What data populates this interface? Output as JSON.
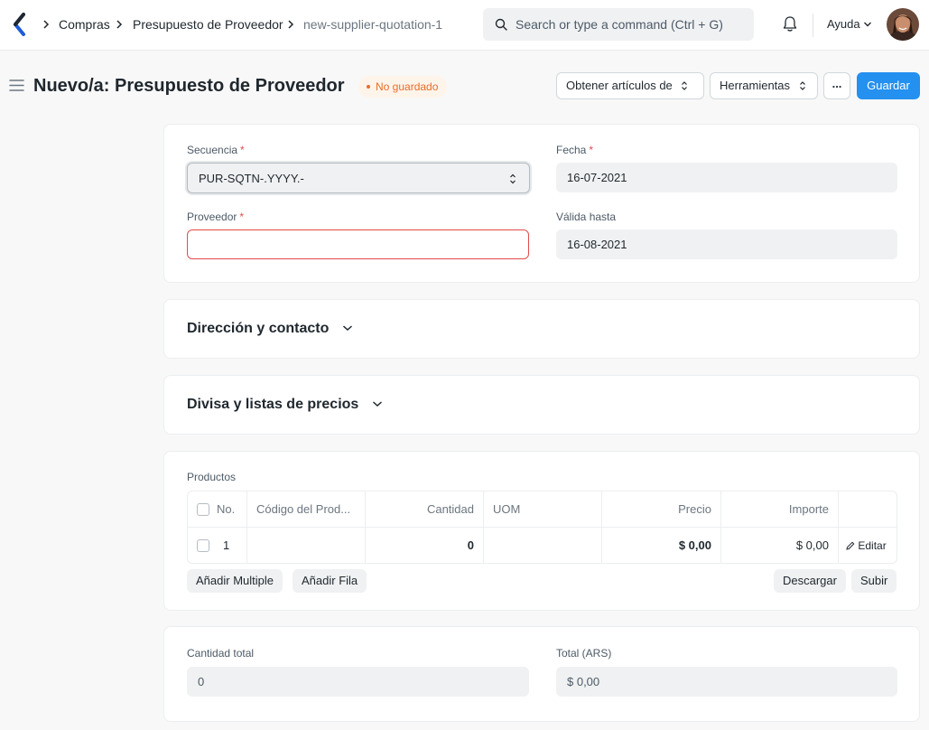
{
  "navbar": {
    "breadcrumbs": [
      "Compras",
      "Presupuesto de Proveedor",
      "new-supplier-quotation-1"
    ],
    "search_placeholder": "Search or type a command (Ctrl + G)",
    "help_label": "Ayuda"
  },
  "page": {
    "title": "Nuevo/a: Presupuesto de Proveedor",
    "status_badge": "No guardado",
    "actions": {
      "get_items": "Obtener artículos de",
      "tools": "Herramientas",
      "more": "...",
      "save": "Guardar"
    }
  },
  "form": {
    "series_label": "Secuencia",
    "series_value": "PUR-SQTN-.YYYY.-",
    "date_label": "Fecha",
    "date_value": "16-07-2021",
    "supplier_label": "Proveedor",
    "supplier_value": "",
    "valid_till_label": "Válida hasta",
    "valid_till_value": "16-08-2021"
  },
  "sections": {
    "address": "Dirección y contacto",
    "currency": "Divisa y listas de precios"
  },
  "items": {
    "label": "Productos",
    "columns": {
      "no": "No.",
      "item_code": "Código del Prod...",
      "qty": "Cantidad",
      "uom": "UOM",
      "rate": "Precio",
      "amount": "Importe"
    },
    "rows": [
      {
        "no": "1",
        "item_code": "",
        "qty": "0",
        "uom": "",
        "rate": "$ 0,00",
        "amount": "$ 0,00",
        "edit": "Editar"
      }
    ],
    "buttons": {
      "add_multiple": "Añadir Multiple",
      "add_row": "Añadir Fila",
      "download": "Descargar",
      "upload": "Subir"
    }
  },
  "totals": {
    "total_qty_label": "Cantidad total",
    "total_qty_value": "0",
    "total_label": "Total (ARS)",
    "total_value": "$ 0,00"
  }
}
